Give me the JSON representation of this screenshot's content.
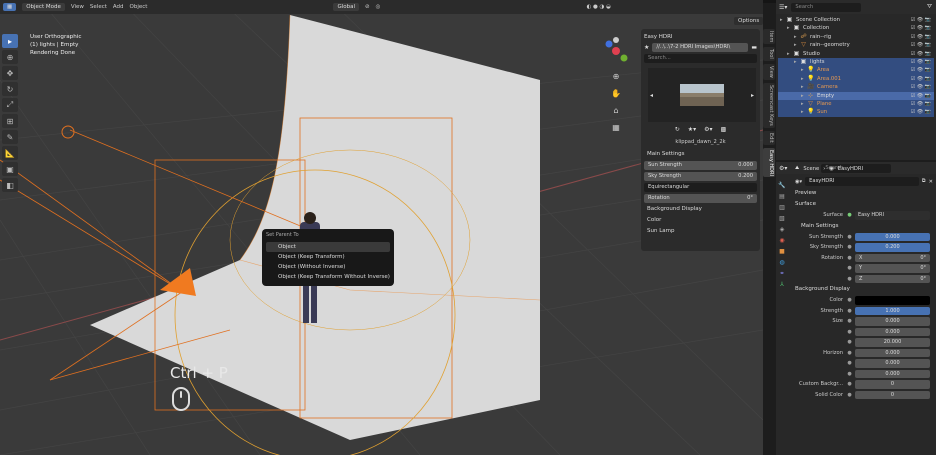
{
  "header": {
    "mode": "Object Mode",
    "menus": [
      "View",
      "Select",
      "Add",
      "Object"
    ],
    "transform": "Global",
    "options": "Options"
  },
  "viewport": {
    "info": [
      "User Orthographic",
      "(1) lights | Empty",
      "Rendering Done"
    ],
    "shortcut": "Ctrl + P"
  },
  "context_menu": {
    "title": "Set Parent To",
    "items": [
      "Object",
      "Object (Keep Transform)",
      "Object (Without Inverse)",
      "Object (Keep Transform Without Inverse)"
    ]
  },
  "npanel": {
    "title": "Easy HDRI",
    "path": "//..\\..\\7-2 HDRI Images\\HDRI\\",
    "search": "Search...",
    "hdri_name": "klippad_dawn_2_2k",
    "main_settings": "Main Settings",
    "sun_strength": {
      "label": "Sun Strength",
      "value": "0.000"
    },
    "sky_strength": {
      "label": "Sky Strength",
      "value": "0.200"
    },
    "projection": "Equirectangular",
    "rotation": {
      "label": "Rotation",
      "value": "0°"
    },
    "sections": [
      "Background Display",
      "Color",
      "Sun Lamp"
    ]
  },
  "side_tabs": [
    "Item",
    "Tool",
    "View",
    "Screencast Keys",
    "Edit",
    "Easy HDRI"
  ],
  "outliner": {
    "search": "Search",
    "rows": [
      {
        "label": "Scene Collection",
        "depth": 0,
        "icon": "collection-icon"
      },
      {
        "label": "Collection",
        "depth": 1,
        "icon": "collection-icon"
      },
      {
        "label": "rain--rig",
        "depth": 2,
        "icon": "armature-icon"
      },
      {
        "label": "rain--geometry",
        "depth": 2,
        "icon": "mesh-icon"
      },
      {
        "label": "Studio",
        "depth": 1,
        "icon": "collection-icon"
      },
      {
        "label": "lights",
        "depth": 2,
        "icon": "collection-icon",
        "sel": true
      },
      {
        "label": "Area",
        "depth": 3,
        "icon": "light-icon",
        "sel": true,
        "orange": true
      },
      {
        "label": "Area.001",
        "depth": 3,
        "icon": "light-icon",
        "sel": true,
        "orange": true
      },
      {
        "label": "Camera",
        "depth": 3,
        "icon": "camera-icon",
        "sel": true,
        "orange": true
      },
      {
        "label": "Empty",
        "depth": 3,
        "icon": "empty-icon",
        "hl": true
      },
      {
        "label": "Plane",
        "depth": 3,
        "icon": "mesh-icon",
        "sel": true,
        "orange": true
      },
      {
        "label": "Sun",
        "depth": 3,
        "icon": "light-icon",
        "sel": true,
        "orange": true
      }
    ]
  },
  "properties": {
    "breadcrumb": [
      "Scene",
      "EasyHDRI"
    ],
    "world": "EasyHDRI",
    "search": "Search",
    "sections": {
      "preview": "Preview",
      "surface": "Surface",
      "main": "Main Settings",
      "bg": "Background Display"
    },
    "surface": {
      "label": "Surface",
      "value": "Easy HDRI"
    },
    "rows": [
      {
        "label": "Sun Strength",
        "value": "0.000",
        "kind": "blue"
      },
      {
        "label": "Sky Strength",
        "value": "0.200",
        "kind": "blue"
      },
      {
        "label": "Rotation",
        "value": "X",
        "v2": "0°"
      },
      {
        "label": "",
        "value": "Y",
        "v2": "0°"
      },
      {
        "label": "",
        "value": "Z",
        "v2": "0°"
      }
    ],
    "bgrows": [
      {
        "label": "Color",
        "value": "",
        "kind": "black"
      },
      {
        "label": "Strength",
        "value": "1.000",
        "kind": "blue"
      },
      {
        "label": "Size",
        "value": "0.000"
      },
      {
        "label": "",
        "value": "0.000"
      },
      {
        "label": "",
        "value": "20.000"
      },
      {
        "label": "Horizon",
        "value": "0.000"
      },
      {
        "label": "",
        "value": "0.000"
      },
      {
        "label": "",
        "value": "0.000"
      },
      {
        "label": "Custom Backgr...",
        "value": "0"
      },
      {
        "label": "Solid Color",
        "value": "0"
      }
    ]
  }
}
